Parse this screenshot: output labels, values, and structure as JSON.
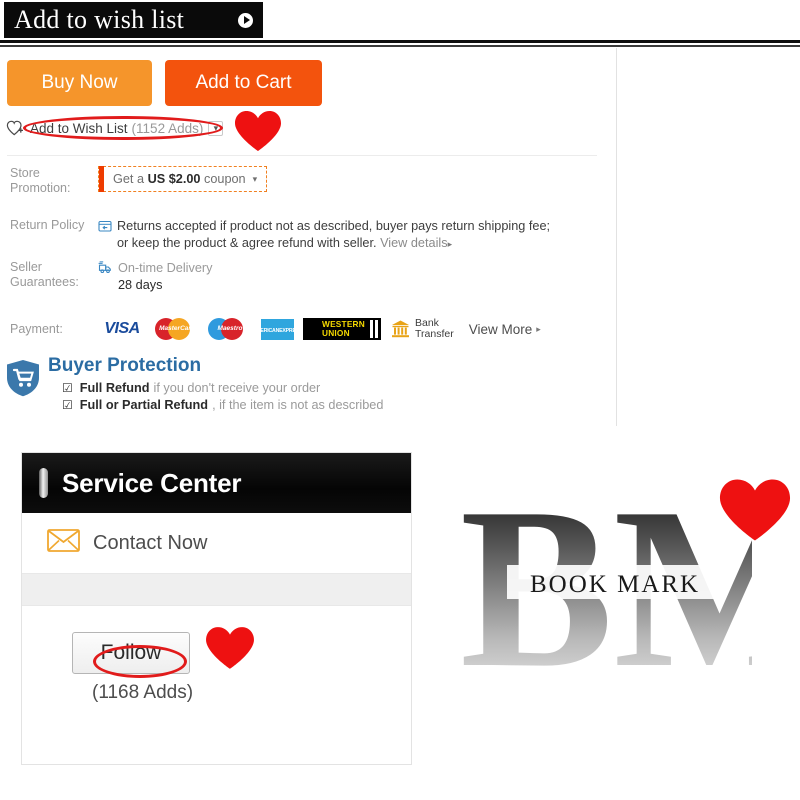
{
  "banner": {
    "title": "Add to wish list",
    "play_icon": "play-circle-icon"
  },
  "actions": {
    "buy_now": "Buy Now",
    "add_to_cart": "Add to Cart",
    "buy_now_color": "#f5952b",
    "add_to_cart_color": "#f3530d"
  },
  "wishlist": {
    "icon": "heart-plus-icon",
    "label": "Add to Wish List",
    "count": "(1152 Adds)",
    "chevron": "⌄"
  },
  "info": {
    "store_promotion": {
      "label": "Store Promotion:",
      "coupon_prefix": "Get a ",
      "coupon_amount": "US $2.00",
      "coupon_suffix": " coupon",
      "caret": "▾",
      "accent": "#ee3b00"
    },
    "return_policy": {
      "label": "Return Policy",
      "icon": "return-box-icon",
      "line1": "Returns accepted if product not as described, buyer pays return shipping fee;",
      "line2_main": "or keep the product & agree refund with seller. ",
      "view_details": "View details",
      "caret": "▸"
    },
    "seller_guarantees": {
      "label": "Seller Guarantees:",
      "icon": "delivery-truck-icon",
      "title": "On-time Delivery",
      "value": "28 days"
    },
    "payment": {
      "label": "Payment:",
      "methods": [
        {
          "name": "visa-logo",
          "text": "VISA"
        },
        {
          "name": "mastercard-logo",
          "text": "MasterCard"
        },
        {
          "name": "maestro-logo",
          "text": "Maestro"
        },
        {
          "name": "amex-logo",
          "line1": "AMERICAN",
          "line2": "EXPRESS"
        },
        {
          "name": "western-union-logo",
          "line1": "WESTERN",
          "line2": "UNION"
        },
        {
          "name": "bank-transfer-logo",
          "line1": "Bank",
          "line2": "Transfer"
        }
      ],
      "view_more": "View More",
      "caret": "▸"
    }
  },
  "buyer_protection": {
    "icon": "shield-cart-icon",
    "title": "Buyer Protection",
    "title_color": "#2b6ca3",
    "items": [
      {
        "check": "☑",
        "bold": "Full Refund",
        "rest": "if you don't receive your order"
      },
      {
        "check": "☑",
        "bold": "Full or Partial Refund",
        "rest": ", if the item is not as described"
      }
    ]
  },
  "service_center": {
    "title": "Service Center",
    "contact_icon": "envelope-icon",
    "contact_label": "Contact Now",
    "follow_label": "Follow",
    "follow_count": "(1168 Adds)"
  },
  "brand_logo": {
    "monogram": "BM",
    "wordmark": "BOOK MARK"
  },
  "annotations": {
    "highlight_color": "#e11b1b",
    "marks": [
      "heart-mark",
      "heart-mark",
      "heart-mark"
    ],
    "ellipses": [
      "wishlist-ellipse",
      "follow-ellipse"
    ]
  }
}
